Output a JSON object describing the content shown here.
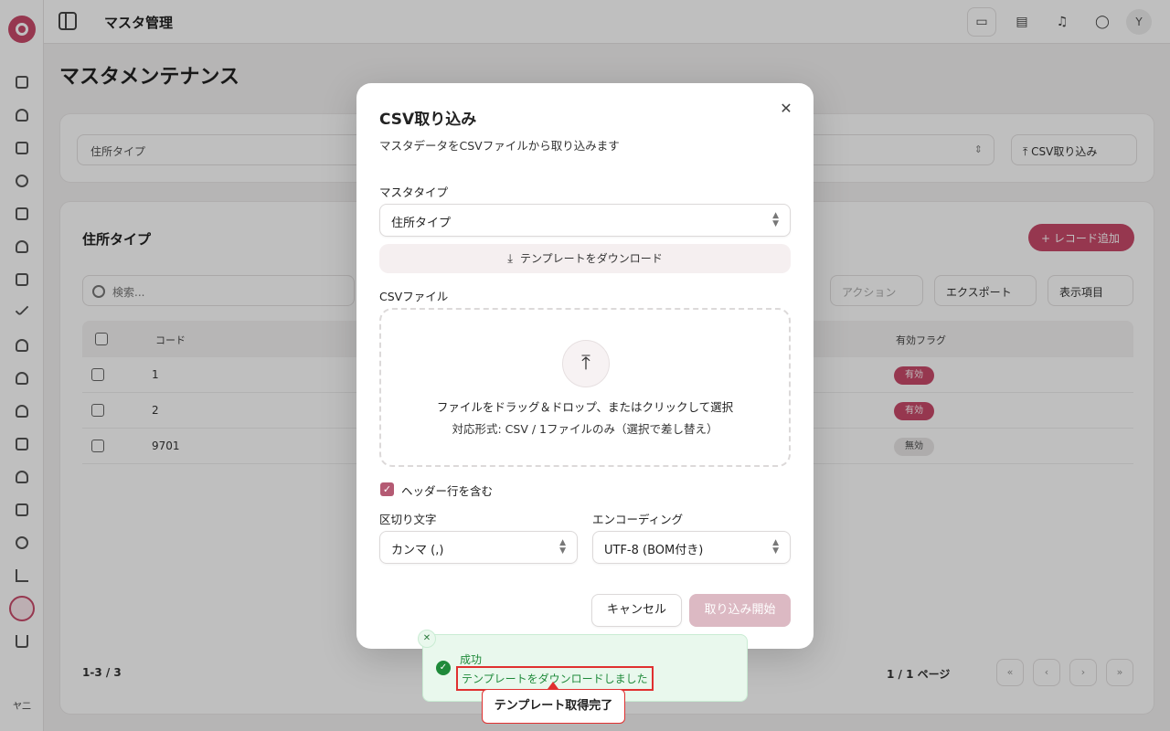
{
  "topbar": {
    "title": "マスタ管理",
    "user_initial": "Y"
  },
  "sidebar": {
    "user_label": "ヤ二"
  },
  "page": {
    "title": "マスタメンテナンス"
  },
  "filter_card": {
    "select_value": "住所タイプ",
    "import_button": "CSV取り込み"
  },
  "list_card": {
    "title": "住所タイプ",
    "add_button": "+ レコード追加",
    "search_placeholder": "検索...",
    "actions_button": "アクション",
    "export_button": "エクスポート",
    "columns_button": "表示項目",
    "columns": [
      "コード",
      "有効フラグ"
    ],
    "rows": [
      {
        "code": "1",
        "flag": "有効",
        "active": true
      },
      {
        "code": "2",
        "flag": "有効",
        "active": true
      },
      {
        "code": "9701",
        "flag": "無効",
        "active": false
      }
    ],
    "range_text": "1-3 / 3",
    "page_text": "1 / 1 ページ"
  },
  "modal": {
    "title": "CSV取り込み",
    "description": "マスタデータをCSVファイルから取り込みます",
    "master_type_label": "マスタタイプ",
    "master_type_value": "住所タイプ",
    "template_download": "テンプレートをダウンロード",
    "csv_file_label": "CSVファイル",
    "dropzone_main": "ファイルをドラッグ＆ドロップ、またはクリックして選択",
    "dropzone_sub": "対応形式: CSV / 1ファイルのみ（選択で差し替え）",
    "header_row_label": "ヘッダー行を含む",
    "header_row_checked": true,
    "delimiter_label": "区切り文字",
    "delimiter_value": "カンマ (,)",
    "encoding_label": "エンコーディング",
    "encoding_value": "UTF-8 (BOM付き)",
    "cancel_button": "キャンセル",
    "start_button": "取り込み開始"
  },
  "toast": {
    "title": "成功",
    "message": "テンプレートをダウンロードしました",
    "status_color": "#1f8a3a"
  },
  "callout": {
    "text": "テンプレート取得完了"
  },
  "colors": {
    "accent": "#c94a6a",
    "start_disabled": "#dcb9c3"
  }
}
